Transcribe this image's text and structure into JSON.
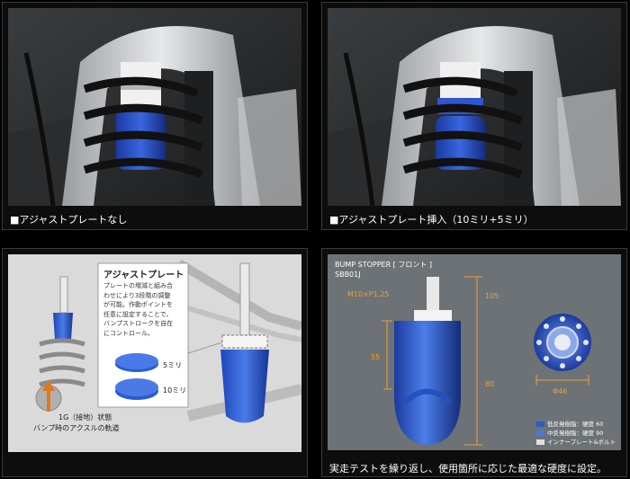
{
  "panels": {
    "top_left": {
      "caption": "■アジャストプレートなし"
    },
    "top_right": {
      "caption": "■アジャストプレート挿入（10ミリ+5ミリ）"
    },
    "bottom_left": {
      "callout_title": "アジャストプレート",
      "callout_lines": [
        "プレートの増減と組み合",
        "わせにより3段階の調整",
        "が可能。作動ポイントを",
        "任意に設定することで、",
        "バンプストロークを自在",
        "にコントロール。"
      ],
      "plate_5_label": "5ミリ",
      "plate_10_label": "10ミリ",
      "state_label": "1G（接地）状態",
      "axle_label": "バンプ時のアクスルの軌道"
    },
    "bottom_right": {
      "title": "BUMP STOPPER [ フロント ]",
      "part_no": "SBB01J",
      "thread_label": "M10×P1.25",
      "dim_105": "105",
      "dim_55": "55",
      "dim_80": "80",
      "dim_phi46": "Φ46",
      "legend": [
        {
          "label": "低反発樹脂：硬度 60",
          "color": "#2a5cc8"
        },
        {
          "label": "中反発樹脂：硬度 90",
          "color": "#4a78e0"
        },
        {
          "label": "インナープレート&ボルト",
          "color": "#e0e0e0"
        }
      ],
      "caption": "実走テストを繰り返し、使用箇所に応じた最適な硬度に設定。"
    }
  }
}
